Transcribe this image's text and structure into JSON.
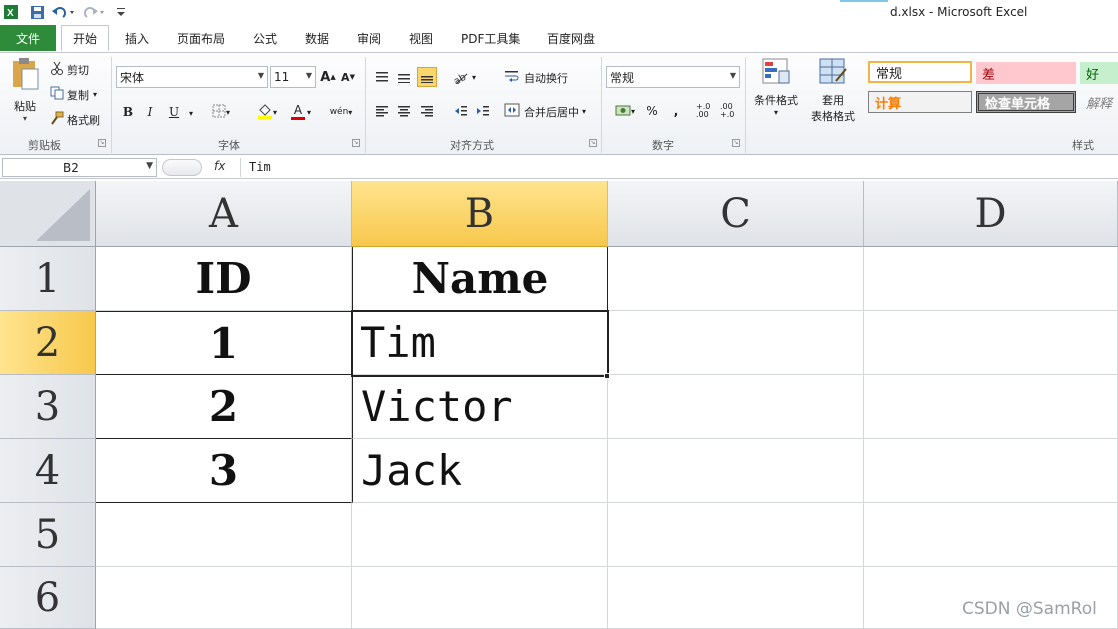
{
  "window": {
    "title": "d.xlsx  -  Microsoft Excel"
  },
  "ribbon": {
    "tabs": [
      {
        "label": "文件",
        "active": false
      },
      {
        "label": "开始",
        "active": true
      },
      {
        "label": "插入",
        "active": false
      },
      {
        "label": "页面布局",
        "active": false
      },
      {
        "label": "公式",
        "active": false
      },
      {
        "label": "数据",
        "active": false
      },
      {
        "label": "审阅",
        "active": false
      },
      {
        "label": "视图",
        "active": false
      },
      {
        "label": "PDF工具集",
        "active": false
      },
      {
        "label": "百度网盘",
        "active": false
      }
    ],
    "clipboard": {
      "paste": "粘贴",
      "cut": "剪切",
      "copy": "复制",
      "format_painter": "格式刷",
      "group": "剪贴板"
    },
    "font": {
      "name": "宋体",
      "size": "11",
      "bold": "B",
      "italic": "I",
      "underline": "U",
      "font_color_letter": "A",
      "wen": "wén",
      "group": "字体",
      "grow": "A",
      "shrink": "A"
    },
    "alignment": {
      "wrap": "自动换行",
      "merge": "合并后居中",
      "group": "对齐方式"
    },
    "number": {
      "format": "常规",
      "percent": "%",
      "comma": ",",
      "inc_decimal": "+.0 .00",
      "dec_decimal": ".00 +.0",
      "group": "数字"
    },
    "styles": {
      "conditional": "条件格式",
      "table_format_line1": "套用",
      "table_format_line2": "表格格式",
      "normal": "常规",
      "bad": "差",
      "good": "好",
      "calculation": "计算",
      "check_cell": "检查单元格",
      "explanatory": "解释",
      "group": "样式"
    }
  },
  "formula_bar": {
    "name_box": "B2",
    "fx": "fx",
    "value": "Tim"
  },
  "sheet": {
    "columns": [
      "A",
      "B",
      "C",
      "D"
    ],
    "rows": [
      "1",
      "2",
      "3",
      "4",
      "5",
      "6"
    ],
    "cells": {
      "A1": "ID",
      "B1": "Name",
      "A2": "1",
      "B2": "Tim",
      "A3": "2",
      "B3": "Victor",
      "A4": "3",
      "B4": "Jack"
    },
    "selected_cell": "B2"
  },
  "watermark": "CSDN @SamRol",
  "colors": {
    "file_tab": "#2e8b3a",
    "selection_header": "#f7c84c",
    "bad_fill": "#ffc7ce",
    "good_fill": "#c6efce",
    "calc_text": "#fa7d00"
  }
}
